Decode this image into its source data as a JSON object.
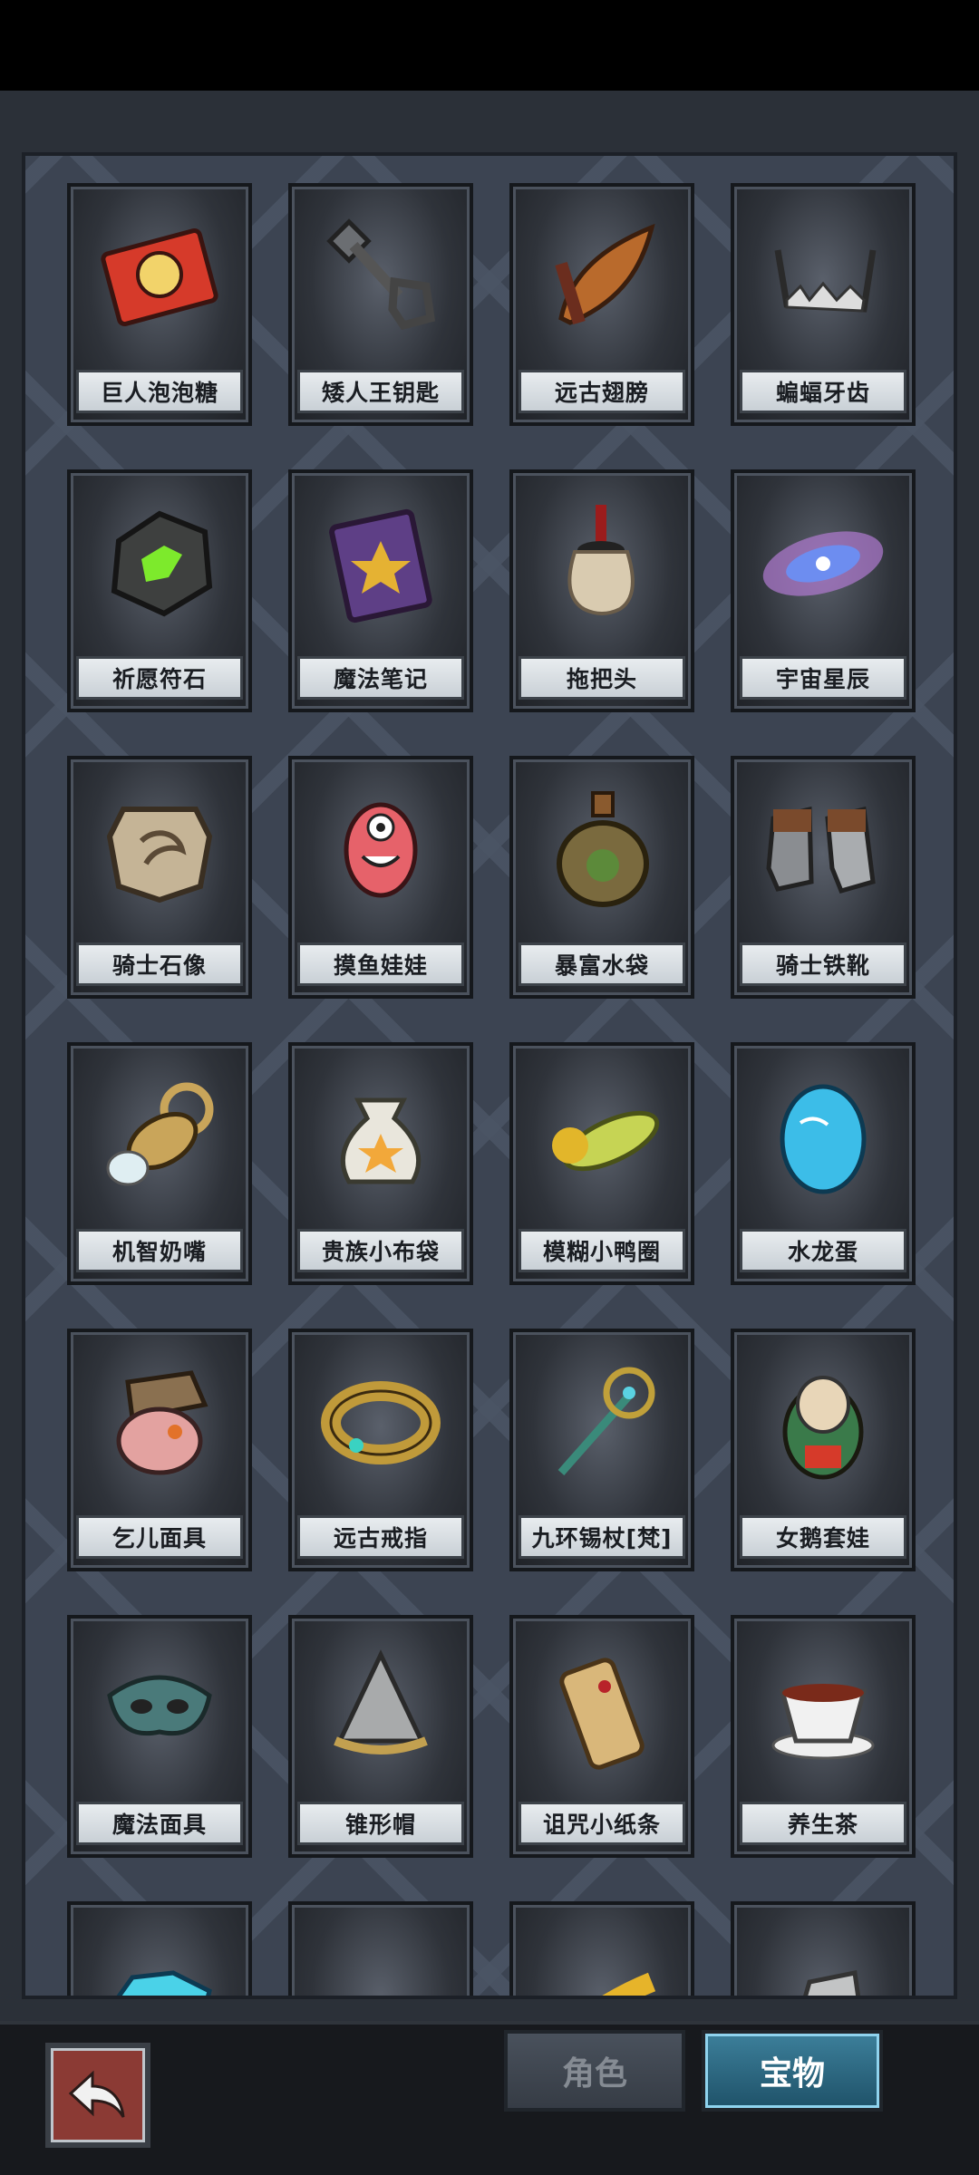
{
  "treasures": [
    {
      "name": "巨人泡泡糖",
      "icon": "bubble-gum-box-icon"
    },
    {
      "name": "矮人王钥匙",
      "icon": "dwarf-key-icon"
    },
    {
      "name": "远古翅膀",
      "icon": "ancient-wing-icon"
    },
    {
      "name": "蝙蝠牙齿",
      "icon": "bat-teeth-icon"
    },
    {
      "name": "祈愿符石",
      "icon": "wish-rune-stone-icon"
    },
    {
      "name": "魔法笔记",
      "icon": "magic-book-icon"
    },
    {
      "name": "拖把头",
      "icon": "mop-head-icon"
    },
    {
      "name": "宇宙星辰",
      "icon": "galaxy-icon"
    },
    {
      "name": "骑士石像",
      "icon": "knight-stone-icon"
    },
    {
      "name": "摸鱼娃娃",
      "icon": "slacker-doll-icon"
    },
    {
      "name": "暴富水袋",
      "icon": "water-flask-icon"
    },
    {
      "name": "骑士铁靴",
      "icon": "iron-boots-icon"
    },
    {
      "name": "机智奶嘴",
      "icon": "pacifier-icon"
    },
    {
      "name": "贵族小布袋",
      "icon": "cloth-bag-icon"
    },
    {
      "name": "模糊小鸭圈",
      "icon": "duck-ring-icon"
    },
    {
      "name": "水龙蛋",
      "icon": "water-dragon-egg-icon"
    },
    {
      "name": "乞儿面具",
      "icon": "beggar-mask-icon"
    },
    {
      "name": "远古戒指",
      "icon": "ancient-ring-icon"
    },
    {
      "name": "九环锡杖[梵]",
      "icon": "staff-icon"
    },
    {
      "name": "女鹅套娃",
      "icon": "nesting-doll-icon"
    },
    {
      "name": "魔法面具",
      "icon": "magic-mask-icon"
    },
    {
      "name": "锥形帽",
      "icon": "cone-helmet-icon"
    },
    {
      "name": "诅咒小纸条",
      "icon": "cursed-scroll-icon"
    },
    {
      "name": "养生茶",
      "icon": "tea-cup-icon"
    },
    {
      "name": "",
      "icon": "blue-crystal-icon"
    },
    {
      "name": "",
      "icon": "knit-hat-icon"
    },
    {
      "name": "",
      "icon": "yellow-item-icon"
    },
    {
      "name": "",
      "icon": "silver-item-icon"
    }
  ],
  "tabs": {
    "role": "角色",
    "treasure": "宝物"
  },
  "colors": {
    "accent": "#2a7090",
    "back_button": "#8b3a34",
    "panel": "#3c4452"
  }
}
